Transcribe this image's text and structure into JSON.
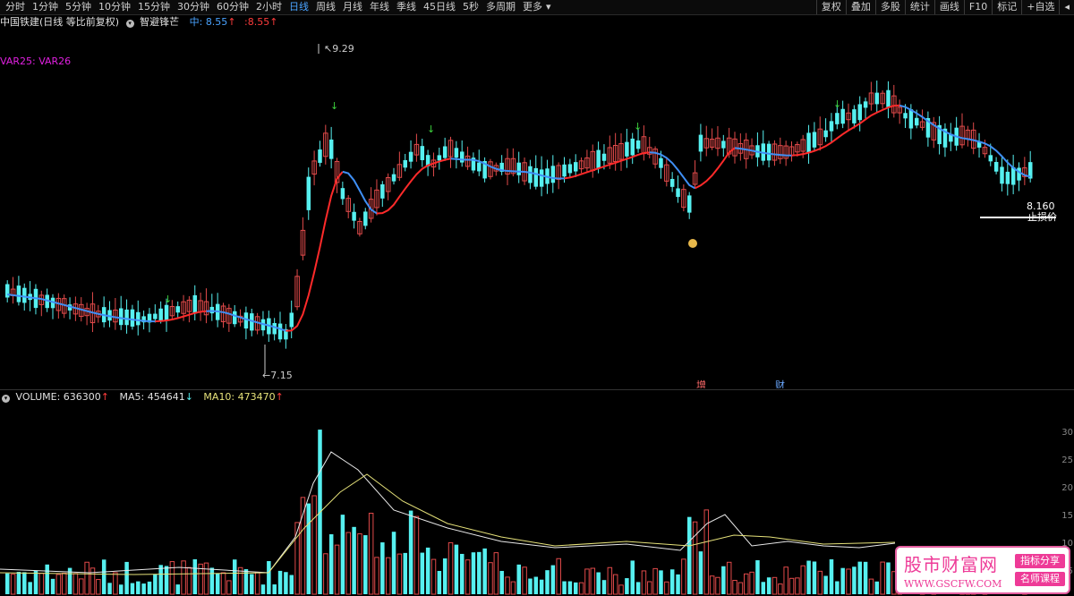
{
  "toolbar": {
    "periods": [
      "分时",
      "1分钟",
      "5分钟",
      "10分钟",
      "15分钟",
      "30分钟",
      "60分钟",
      "2小时",
      "日线",
      "周线",
      "月线",
      "年线",
      "季线",
      "45日线",
      "5秒",
      "多周期",
      "更多"
    ],
    "active_period": "日线",
    "right_buttons": [
      "复权",
      "叠加",
      "多股",
      "统计",
      "画线",
      "F10",
      "标记",
      "+自选"
    ],
    "right_icon": "back-arrow-icon"
  },
  "stock": {
    "name": "中国铁建(日线 等比前复权)",
    "indicator": "智避锋芒",
    "mid_label": "中:",
    "mid_value": "8.55",
    "colon_value": ":8.55",
    "var_label": "VAR25: VAR26"
  },
  "main_labels": {
    "high": "9.29",
    "low": "7.15",
    "stop_value": "8.160",
    "stop_text": "止损价",
    "marker_zeng": "增",
    "marker_cai": "财"
  },
  "volume_info": {
    "volume_label": "VOLUME: 636300",
    "ma5_label": "MA5: 454641",
    "ma10_label": "MA10: 473470"
  },
  "right_axis": [
    "30",
    "25",
    "20",
    "15",
    "10",
    "5"
  ],
  "watermark": {
    "title": "股市财富网",
    "tag1": "指标分享",
    "tag2": "名师课程",
    "url": "WWW.GSCFW.COM"
  },
  "colors": {
    "up": "#e14a4a",
    "down": "#56f0f0",
    "ma_red": "#ff2a2a",
    "ma_blue": "#3f8ff5",
    "vol_ma5": "#e8e8e8",
    "vol_ma10": "#e6e27a",
    "active": "#4aa3ff"
  }
}
